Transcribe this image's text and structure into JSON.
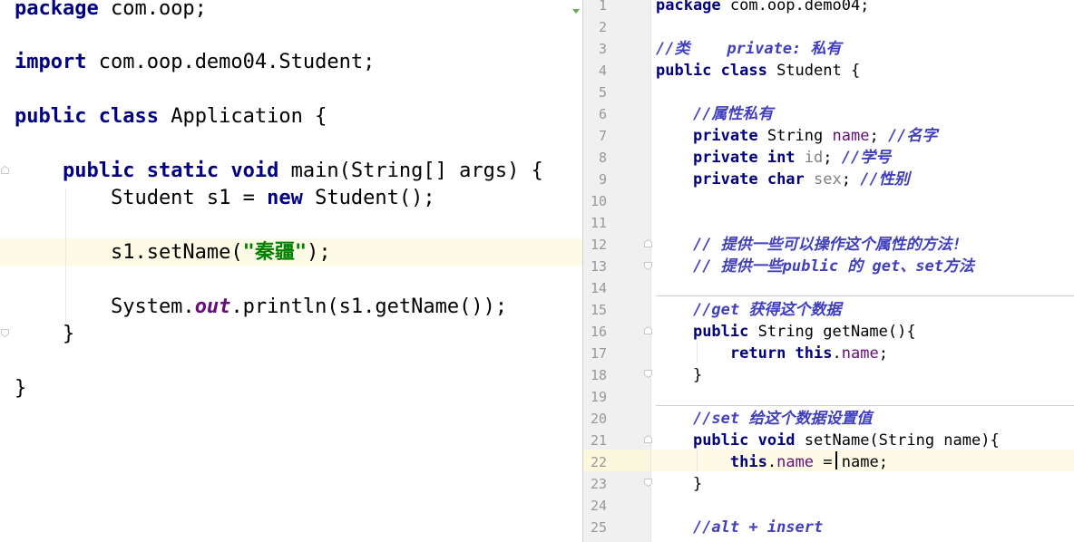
{
  "left_editor": {
    "lines": [
      {
        "segments": [
          {
            "t": "package",
            "c": "kw"
          },
          {
            "t": " com.oop;"
          }
        ]
      },
      {
        "segments": [
          {
            "t": "import",
            "c": "kw"
          },
          {
            "t": " com.oop.demo04.Student;"
          }
        ]
      },
      {
        "segments": [
          {
            "t": "public class",
            "c": "kw"
          },
          {
            "t": " Application {"
          }
        ]
      },
      {
        "segments": [
          {
            "t": "    "
          },
          {
            "t": "public static void",
            "c": "kw"
          },
          {
            "t": " main(String[] args) {"
          }
        ]
      },
      {
        "segments": [
          {
            "t": "        Student s1 = "
          },
          {
            "t": "new",
            "c": "kw"
          },
          {
            "t": " Student();"
          }
        ]
      },
      {
        "segments": [
          {
            "t": "        s1.setName("
          },
          {
            "t": "\"秦疆\"",
            "c": "str"
          },
          {
            "t": ");"
          }
        ]
      },
      {
        "segments": [
          {
            "t": "        System."
          },
          {
            "t": "out",
            "c": "sfld"
          },
          {
            "t": ".println(s1.getName());"
          }
        ]
      },
      {
        "segments": [
          {
            "t": "    }"
          }
        ]
      },
      {
        "segments": [
          {
            "t": "}"
          }
        ]
      }
    ]
  },
  "right_editor": {
    "line_numbers": [
      "1",
      "2",
      "3",
      "4",
      "5",
      "6",
      "7",
      "8",
      "9",
      "10",
      "11",
      "12",
      "13",
      "14",
      "15",
      "16",
      "17",
      "18",
      "19",
      "20",
      "21",
      "22",
      "23",
      "24",
      "25"
    ],
    "lines": [
      {
        "segments": [
          {
            "t": "package",
            "c": "kw"
          },
          {
            "t": " com.oop.demo04;"
          }
        ]
      },
      {
        "segments": []
      },
      {
        "segments": [
          {
            "t": "//类    private: 私有",
            "c": "cmt"
          }
        ]
      },
      {
        "segments": [
          {
            "t": "public class",
            "c": "kw"
          },
          {
            "t": " Student {"
          }
        ]
      },
      {
        "segments": []
      },
      {
        "segments": [
          {
            "t": "    "
          },
          {
            "t": "//属性私有",
            "c": "cmt"
          }
        ]
      },
      {
        "segments": [
          {
            "t": "    "
          },
          {
            "t": "private",
            "c": "kw"
          },
          {
            "t": " String "
          },
          {
            "t": "name",
            "c": "fld"
          },
          {
            "t": "; "
          },
          {
            "t": "//名字",
            "c": "cmt"
          }
        ]
      },
      {
        "segments": [
          {
            "t": "    "
          },
          {
            "t": "private int",
            "c": "kw"
          },
          {
            "t": " "
          },
          {
            "t": "id",
            "c": "unused"
          },
          {
            "t": "; "
          },
          {
            "t": "//学号",
            "c": "cmt"
          }
        ]
      },
      {
        "segments": [
          {
            "t": "    "
          },
          {
            "t": "private char",
            "c": "kw"
          },
          {
            "t": " "
          },
          {
            "t": "sex",
            "c": "unused"
          },
          {
            "t": "; "
          },
          {
            "t": "//性别",
            "c": "cmt"
          }
        ]
      },
      {
        "segments": []
      },
      {
        "segments": []
      },
      {
        "segments": [
          {
            "t": "    "
          },
          {
            "t": "// 提供一些可以操作这个属性的方法!",
            "c": "cmt"
          }
        ]
      },
      {
        "segments": [
          {
            "t": "    "
          },
          {
            "t": "// 提供一些public 的 get、set方法",
            "c": "cmt"
          }
        ]
      },
      {
        "segments": []
      },
      {
        "segments": [
          {
            "t": "    "
          },
          {
            "t": "//get 获得这个数据",
            "c": "cmt"
          }
        ]
      },
      {
        "segments": [
          {
            "t": "    "
          },
          {
            "t": "public",
            "c": "kw"
          },
          {
            "t": " String getName(){"
          }
        ]
      },
      {
        "segments": [
          {
            "t": "        "
          },
          {
            "t": "return this",
            "c": "kw"
          },
          {
            "t": "."
          },
          {
            "t": "name",
            "c": "fld"
          },
          {
            "t": ";"
          }
        ]
      },
      {
        "segments": [
          {
            "t": "    }"
          }
        ]
      },
      {
        "segments": []
      },
      {
        "segments": [
          {
            "t": "    "
          },
          {
            "t": "//set 给这个数据设置值",
            "c": "cmt"
          }
        ]
      },
      {
        "segments": [
          {
            "t": "    "
          },
          {
            "t": "public void",
            "c": "kw"
          },
          {
            "t": " setName(String name){"
          }
        ]
      },
      {
        "segments": [
          {
            "t": "        "
          },
          {
            "t": "this",
            "c": "kw"
          },
          {
            "t": "."
          },
          {
            "t": "name",
            "c": "fld"
          },
          {
            "t": " = name;"
          }
        ]
      },
      {
        "segments": [
          {
            "t": "    }"
          }
        ]
      },
      {
        "segments": []
      },
      {
        "segments": [
          {
            "t": "    "
          },
          {
            "t": "//alt + insert",
            "c": "cmt"
          }
        ]
      }
    ]
  }
}
